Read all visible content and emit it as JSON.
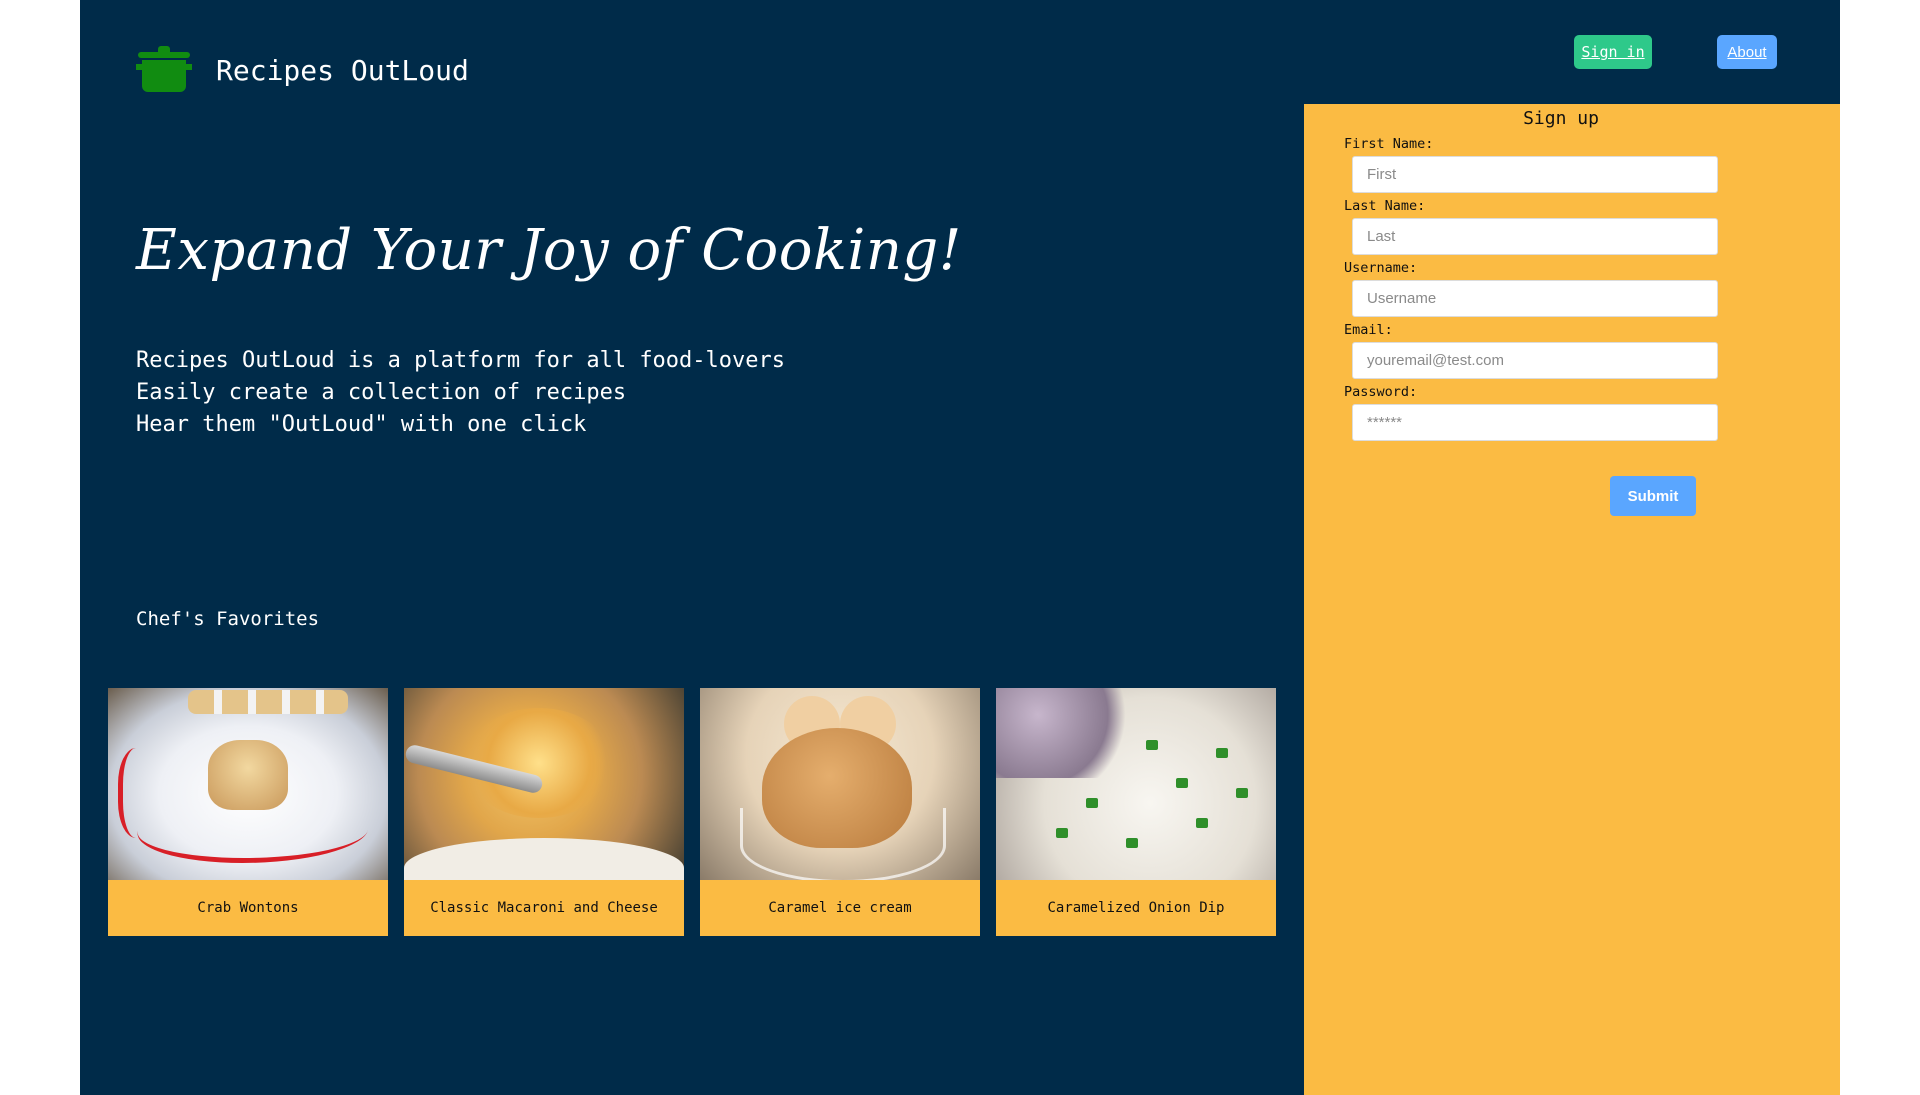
{
  "app": {
    "name": "Recipes OutLoud",
    "logo_icon": "cooking-pot-icon",
    "logo_color": "#118c11"
  },
  "nav": {
    "signin_label": "Sign in",
    "about_label": "About"
  },
  "hero": {
    "title": "Expand Your Joy of Cooking!",
    "lines": [
      "Recipes OutLoud is a platform for all food-lovers",
      "Easily create a collection of recipes",
      "Hear them \"OutLoud\" with one click"
    ]
  },
  "favorites": {
    "title": "Chef's Favorites",
    "items": [
      {
        "label": "Crab Wontons"
      },
      {
        "label": "Classic Macaroni and Cheese"
      },
      {
        "label": "Caramel ice cream"
      },
      {
        "label": "Caramelized Onion Dip"
      }
    ]
  },
  "signup": {
    "title": "Sign up",
    "fields": [
      {
        "label": "First Name:",
        "placeholder": "First"
      },
      {
        "label": "Last Name:",
        "placeholder": "Last"
      },
      {
        "label": "Username:",
        "placeholder": "Username"
      },
      {
        "label": "Email:",
        "placeholder": "youremail@test.com"
      },
      {
        "label": "Password:",
        "placeholder": "******"
      }
    ],
    "submit_label": "Submit"
  },
  "colors": {
    "page_bg": "#002b49",
    "panel_bg": "#fbbb43",
    "signin_bg": "#2ec98a",
    "about_bg": "#5aa6ff",
    "submit_bg": "#5aa6ff"
  }
}
